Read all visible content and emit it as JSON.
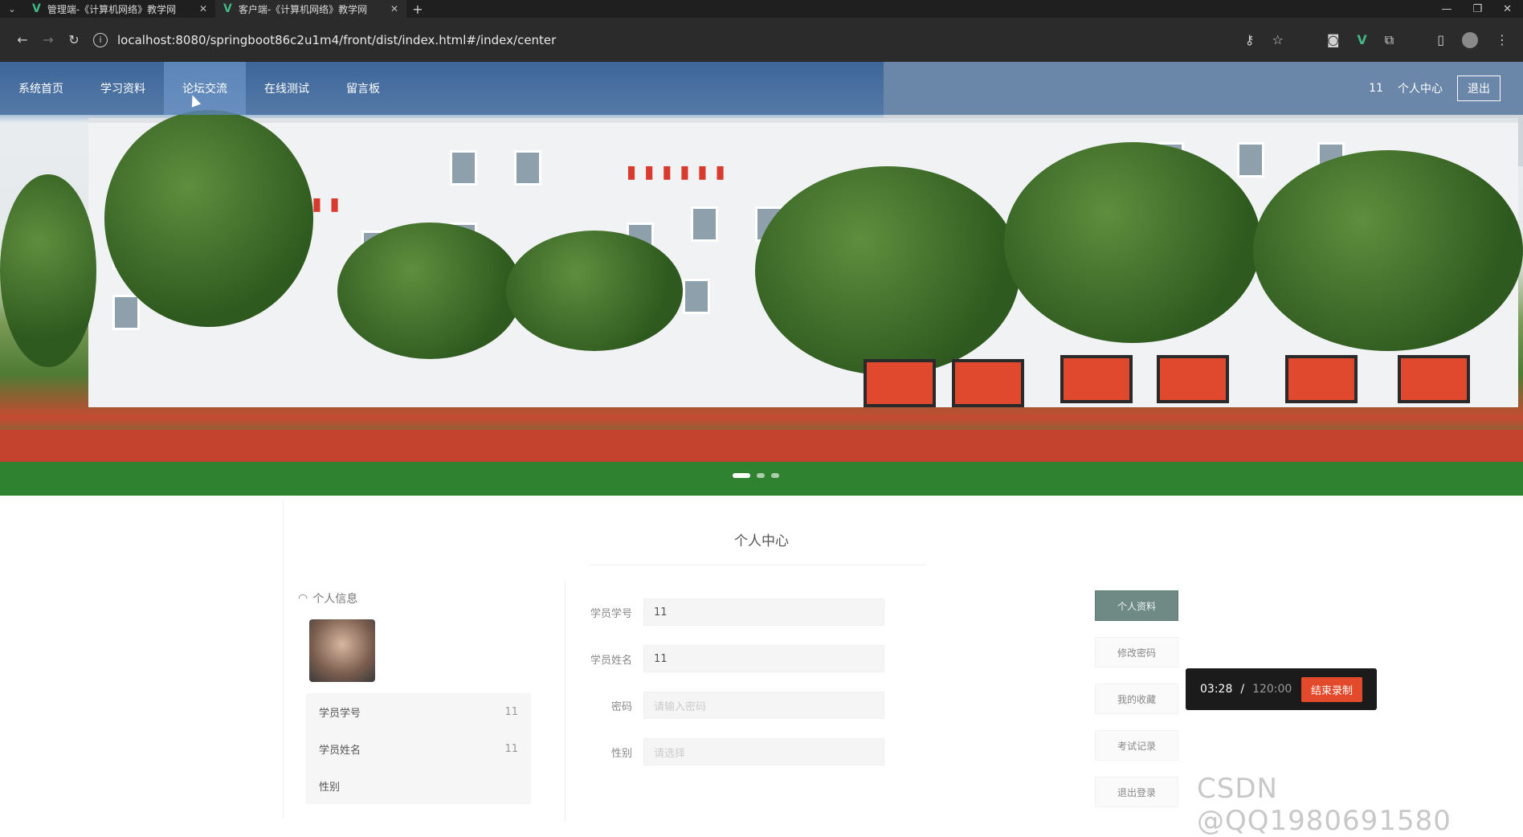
{
  "browser": {
    "tabs": [
      {
        "title": "管理端-《计算机网络》教学网",
        "active": false
      },
      {
        "title": "客户端-《计算机网络》教学网",
        "active": true
      }
    ],
    "url": "localhost:8080/springboot86c2u1m4/front/dist/index.html#/index/center"
  },
  "nav": {
    "items": [
      "系统首页",
      "学习资料",
      "论坛交流",
      "在线测试",
      "留言板"
    ],
    "active_index": 2,
    "user": "11",
    "profile_label": "个人中心",
    "logout_label": "退出"
  },
  "center": {
    "title": "个人中心",
    "card_title": "个人信息",
    "info_rows": [
      {
        "label": "学员学号",
        "value": "11"
      },
      {
        "label": "学员姓名",
        "value": "11"
      },
      {
        "label": "性别",
        "value": ""
      }
    ],
    "form": [
      {
        "label": "学员学号",
        "value": "11",
        "placeholder": false
      },
      {
        "label": "学员姓名",
        "value": "11",
        "placeholder": false
      },
      {
        "label": "密码",
        "value": "请输入密码",
        "placeholder": true
      },
      {
        "label": "性别",
        "value": "请选择",
        "placeholder": true
      }
    ],
    "actions": [
      "个人资料",
      "修改密码",
      "我的收藏",
      "考试记录",
      "退出登录"
    ]
  },
  "recorder": {
    "elapsed": "03:28",
    "total": "120:00",
    "stop_label": "结束录制"
  },
  "watermark": "CSDN @QQ1980691580",
  "colors": {
    "nav_bg": "#184682",
    "primary_btn": "#6f8a85",
    "stop_btn": "#e24a2b"
  }
}
